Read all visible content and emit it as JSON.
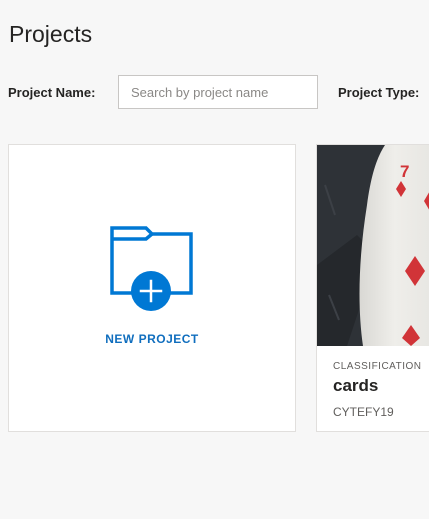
{
  "header": {
    "title": "Projects"
  },
  "filters": {
    "name_label": "Project Name:",
    "name_placeholder": "Search by project name",
    "name_value": "",
    "type_label": "Project Type:"
  },
  "new_project": {
    "label": "NEW PROJECT",
    "icon": "folder-add-icon"
  },
  "projects": [
    {
      "type": "CLASSIFICATION",
      "name": "cards",
      "owner": "CYTEFY19",
      "thumbnail": "playing-card-seven-of-diamonds"
    }
  ],
  "colors": {
    "accent": "#106ebe",
    "icon_blue": "#0078d4",
    "card_red": "#d13438",
    "page_bg": "#f7f7f7"
  }
}
